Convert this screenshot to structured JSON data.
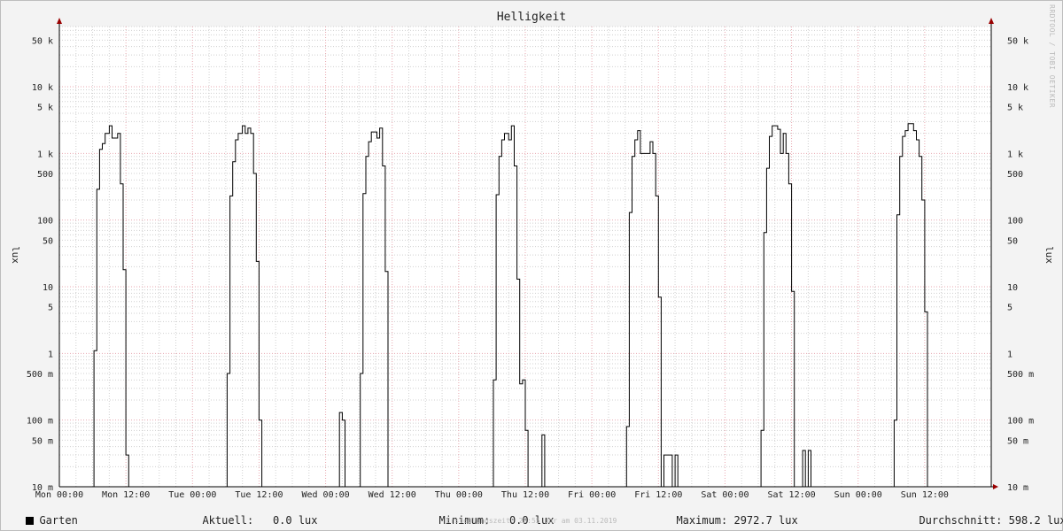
{
  "chart_data": {
    "type": "line",
    "title": "Helligkeit",
    "ylabel": "lux",
    "yscale": "log",
    "ylim": [
      0.01,
      80000
    ],
    "xlim": [
      "Mon 00:00",
      "Sun 23:00"
    ],
    "x_unit": "hours",
    "grid": true,
    "x_ticks": [
      {
        "label": "Mon 00:00",
        "hour": 0
      },
      {
        "label": "Mon 12:00",
        "hour": 12
      },
      {
        "label": "Tue 00:00",
        "hour": 24
      },
      {
        "label": "Tue 12:00",
        "hour": 36
      },
      {
        "label": "Wed 00:00",
        "hour": 48
      },
      {
        "label": "Wed 12:00",
        "hour": 60
      },
      {
        "label": "Thu 00:00",
        "hour": 72
      },
      {
        "label": "Thu 12:00",
        "hour": 84
      },
      {
        "label": "Fri 00:00",
        "hour": 96
      },
      {
        "label": "Fri 12:00",
        "hour": 108
      },
      {
        "label": "Sat 00:00",
        "hour": 120
      },
      {
        "label": "Sat 12:00",
        "hour": 132
      },
      {
        "label": "Sun 00:00",
        "hour": 144
      },
      {
        "label": "Sun 12:00",
        "hour": 156
      }
    ],
    "y_ticks": [
      {
        "label": "50 k",
        "value": 50000
      },
      {
        "label": "10 k",
        "value": 10000
      },
      {
        "label": "5 k",
        "value": 5000
      },
      {
        "label": "1 k",
        "value": 1000
      },
      {
        "label": "500",
        "value": 500
      },
      {
        "label": "100",
        "value": 100
      },
      {
        "label": "50",
        "value": 50
      },
      {
        "label": "10",
        "value": 10
      },
      {
        "label": "5",
        "value": 5
      },
      {
        "label": "1",
        "value": 1
      },
      {
        "label": "500 m",
        "value": 0.5
      },
      {
        "label": "100 m",
        "value": 0.1
      },
      {
        "label": "50 m",
        "value": 0.05
      },
      {
        "label": "10 m",
        "value": 0.01
      }
    ],
    "series": [
      {
        "name": "Garten",
        "color": "#000000",
        "points": [
          [
            0,
            0.01
          ],
          [
            6.25,
            0.01
          ],
          [
            6.25,
            1.1
          ],
          [
            6.75,
            1.1
          ],
          [
            6.75,
            290
          ],
          [
            7.25,
            290
          ],
          [
            7.25,
            1150
          ],
          [
            7.75,
            1150
          ],
          [
            7.75,
            1400
          ],
          [
            8.25,
            1400
          ],
          [
            8.25,
            2000
          ],
          [
            9,
            2000
          ],
          [
            9,
            2600
          ],
          [
            9.5,
            2600
          ],
          [
            9.5,
            1700
          ],
          [
            10.5,
            1700
          ],
          [
            10.5,
            2000
          ],
          [
            11,
            2000
          ],
          [
            11,
            350
          ],
          [
            11.5,
            350
          ],
          [
            11.5,
            18
          ],
          [
            12,
            18
          ],
          [
            12,
            0.03
          ],
          [
            12.5,
            0.03
          ],
          [
            12.5,
            0.01
          ],
          [
            30.25,
            0.01
          ],
          [
            30.25,
            0.5
          ],
          [
            30.75,
            0.5
          ],
          [
            30.75,
            230
          ],
          [
            31.25,
            230
          ],
          [
            31.25,
            750
          ],
          [
            31.75,
            750
          ],
          [
            31.75,
            1600
          ],
          [
            32.25,
            1600
          ],
          [
            32.25,
            2000
          ],
          [
            33,
            2000
          ],
          [
            33,
            2600
          ],
          [
            33.5,
            2600
          ],
          [
            33.5,
            2000
          ],
          [
            34,
            2000
          ],
          [
            34,
            2400
          ],
          [
            34.5,
            2400
          ],
          [
            34.5,
            2000
          ],
          [
            35,
            2000
          ],
          [
            35,
            500
          ],
          [
            35.5,
            500
          ],
          [
            35.5,
            24
          ],
          [
            36,
            24
          ],
          [
            36,
            0.1
          ],
          [
            36.5,
            0.1
          ],
          [
            36.5,
            0.01
          ],
          [
            50.5,
            0.01
          ],
          [
            50.5,
            0.13
          ],
          [
            51,
            0.13
          ],
          [
            51,
            0.1
          ],
          [
            51.5,
            0.1
          ],
          [
            51.5,
            0.01
          ],
          [
            54.25,
            0.01
          ],
          [
            54.25,
            0.5
          ],
          [
            54.75,
            0.5
          ],
          [
            54.75,
            250
          ],
          [
            55.25,
            250
          ],
          [
            55.25,
            900
          ],
          [
            55.75,
            900
          ],
          [
            55.75,
            1500
          ],
          [
            56.25,
            1500
          ],
          [
            56.25,
            2100
          ],
          [
            57.25,
            2100
          ],
          [
            57.25,
            1700
          ],
          [
            57.75,
            1700
          ],
          [
            57.75,
            2400
          ],
          [
            58.25,
            2400
          ],
          [
            58.25,
            650
          ],
          [
            58.75,
            650
          ],
          [
            58.75,
            17
          ],
          [
            59.25,
            17
          ],
          [
            59.25,
            0.01
          ],
          [
            78.25,
            0.01
          ],
          [
            78.25,
            0.4
          ],
          [
            78.75,
            0.4
          ],
          [
            78.75,
            240
          ],
          [
            79.25,
            240
          ],
          [
            79.25,
            900
          ],
          [
            79.75,
            900
          ],
          [
            79.75,
            1600
          ],
          [
            80.25,
            1600
          ],
          [
            80.25,
            2000
          ],
          [
            81,
            2000
          ],
          [
            81,
            1600
          ],
          [
            81.5,
            1600
          ],
          [
            81.5,
            2600
          ],
          [
            82,
            2600
          ],
          [
            82,
            650
          ],
          [
            82.5,
            650
          ],
          [
            82.5,
            13
          ],
          [
            83,
            13
          ],
          [
            83,
            0.35
          ],
          [
            83.5,
            0.35
          ],
          [
            83.5,
            0.4
          ],
          [
            84,
            0.4
          ],
          [
            84,
            0.07
          ],
          [
            84.5,
            0.07
          ],
          [
            84.5,
            0.01
          ],
          [
            87,
            0.01
          ],
          [
            87,
            0.06
          ],
          [
            87.5,
            0.06
          ],
          [
            87.5,
            0.01
          ],
          [
            102.25,
            0.01
          ],
          [
            102.25,
            0.08
          ],
          [
            102.75,
            0.08
          ],
          [
            102.75,
            130
          ],
          [
            103.25,
            130
          ],
          [
            103.25,
            900
          ],
          [
            103.75,
            900
          ],
          [
            103.75,
            1600
          ],
          [
            104.25,
            1600
          ],
          [
            104.25,
            2200
          ],
          [
            104.75,
            2200
          ],
          [
            104.75,
            1000
          ],
          [
            106.5,
            1000
          ],
          [
            106.5,
            1500
          ],
          [
            107,
            1500
          ],
          [
            107,
            1000
          ],
          [
            107.5,
            1000
          ],
          [
            107.5,
            230
          ],
          [
            108,
            230
          ],
          [
            108,
            7
          ],
          [
            108.5,
            7
          ],
          [
            108.5,
            0.01
          ],
          [
            109,
            0.01
          ],
          [
            109,
            0.03
          ],
          [
            110.5,
            0.03
          ],
          [
            110.5,
            0.01
          ],
          [
            111,
            0.01
          ],
          [
            111,
            0.03
          ],
          [
            111.5,
            0.03
          ],
          [
            111.5,
            0.01
          ],
          [
            126.5,
            0.01
          ],
          [
            126.5,
            0.07
          ],
          [
            127,
            0.07
          ],
          [
            127,
            65
          ],
          [
            127.5,
            65
          ],
          [
            127.5,
            600
          ],
          [
            128,
            600
          ],
          [
            128,
            1800
          ],
          [
            128.5,
            1800
          ],
          [
            128.5,
            2600
          ],
          [
            129.5,
            2600
          ],
          [
            129.5,
            2300
          ],
          [
            130,
            2300
          ],
          [
            130,
            1000
          ],
          [
            130.5,
            1000
          ],
          [
            130.5,
            2000
          ],
          [
            131,
            2000
          ],
          [
            131,
            1000
          ],
          [
            131.5,
            1000
          ],
          [
            131.5,
            350
          ],
          [
            132,
            350
          ],
          [
            132,
            8.5
          ],
          [
            132.5,
            8.5
          ],
          [
            132.5,
            0.01
          ],
          [
            134,
            0.01
          ],
          [
            134,
            0.035
          ],
          [
            134.5,
            0.035
          ],
          [
            134.5,
            0.01
          ],
          [
            135,
            0.01
          ],
          [
            135,
            0.035
          ],
          [
            135.5,
            0.035
          ],
          [
            135.5,
            0.01
          ],
          [
            150.5,
            0.01
          ],
          [
            150.5,
            0.1
          ],
          [
            151,
            0.1
          ],
          [
            151,
            120
          ],
          [
            151.5,
            120
          ],
          [
            151.5,
            900
          ],
          [
            152,
            900
          ],
          [
            152,
            1800
          ],
          [
            152.5,
            1800
          ],
          [
            152.5,
            2200
          ],
          [
            153,
            2200
          ],
          [
            153,
            2800
          ],
          [
            154,
            2800
          ],
          [
            154,
            2200
          ],
          [
            154.5,
            2200
          ],
          [
            154.5,
            1600
          ],
          [
            155,
            1600
          ],
          [
            155,
            900
          ],
          [
            155.5,
            900
          ],
          [
            155.5,
            200
          ],
          [
            156,
            200
          ],
          [
            156,
            4.2
          ],
          [
            156.5,
            4.2
          ],
          [
            156.5,
            0.01
          ],
          [
            160,
            0.01
          ]
        ]
      }
    ]
  },
  "legend": {
    "series_name": "Garten",
    "aktuell_label": "Aktuell:",
    "aktuell_value": "0.0 lux",
    "minimum_label": "Minimum:",
    "minimum_value": "0.0 lux",
    "maximum_label": "Maximum:",
    "maximum_value": "2972.7 lux",
    "durchschnitt_label": "Durchschnitt:",
    "durchschnitt_value": "598.2 lux"
  },
  "footer": "Erstellungszeit: 23:55 Uhr am 03.11.2019",
  "watermark": "RRDTOOL / TOBI OETIKER",
  "colors": {
    "background": "#f3f3f3",
    "plot_background": "#ffffff",
    "major_grid": "#e8a8b0",
    "minor_grid": "#d0d0d0",
    "line": "#000000",
    "axis_arrow": "#990000"
  }
}
